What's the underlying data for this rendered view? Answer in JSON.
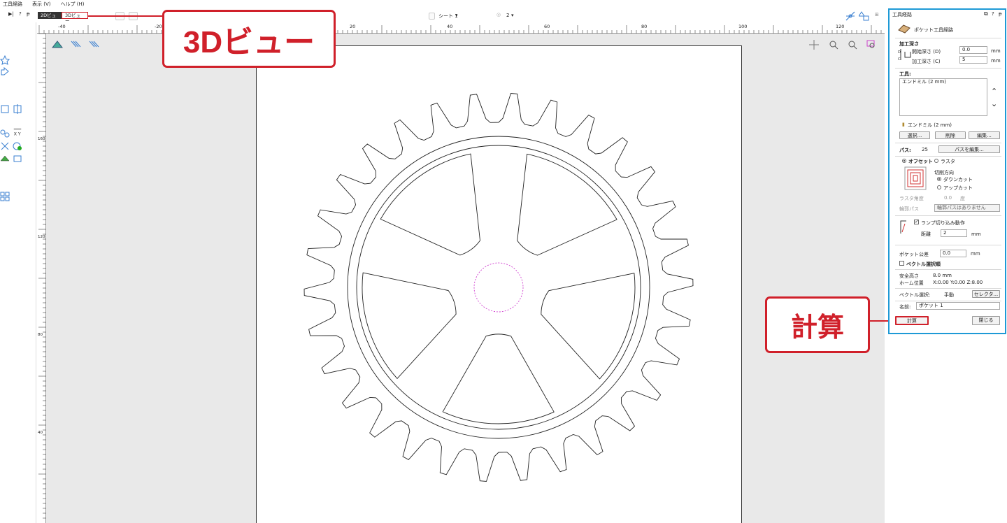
{
  "menu": [
    "工具経路",
    "表示 (V)",
    "ヘルプ (H)"
  ],
  "toolbar": {
    "tab_2d": "2Dビュー",
    "tab_3d": "3Dビュー",
    "sheet_label": "シート 1",
    "layer_label": "2"
  },
  "ruler": {
    "h_labels": [
      "-40",
      "-20",
      "20",
      "40",
      "60",
      "80",
      "100",
      "120"
    ],
    "v_labels": [
      "160",
      "120",
      "80",
      "40",
      "0"
    ]
  },
  "callouts": {
    "view3d": "3Dビュー",
    "calculate": "計算"
  },
  "panel": {
    "header": "工具経路",
    "header_icons": [
      "?",
      "ᵽ"
    ],
    "title": "ポケット工具経路",
    "depth_section": "加工深さ",
    "start_depth_label": "開始深さ (D)",
    "start_depth_value": "0.0",
    "cut_depth_label": "加工深さ (C)",
    "cut_depth_value": "5",
    "unit_mm": "mm",
    "tool_section": "工具:",
    "tool_list_item": "エンドミル (2 mm)",
    "tool_selected": "エンドミル (2 mm)",
    "btn_select": "選択...",
    "btn_delete": "削除",
    "btn_edit": "編集...",
    "pass_label": "パス:",
    "pass_value": "25",
    "btn_edit_pass": "パスを編集...",
    "offset_label": "オフセット",
    "raster_label": "ラスタ",
    "cut_direction_label": "切削方向",
    "down_cut_label": "ダウンカット",
    "up_cut_label": "アップカット",
    "raster_angle_label": "ラスタ角度",
    "raster_angle_value": "0.0",
    "degree_unit": "度",
    "profile_pass_label": "輪郭パス",
    "profile_pass_value": "輪郭パスはありません",
    "ramp_label": "ランプ切り込み動作",
    "distance_label": "距離",
    "distance_value": "2",
    "pocket_allowance_label": "ポケット公差",
    "pocket_allowance_value": "0.0",
    "vector_order_label": "ベクトル選択順",
    "safe_height_label": "安全高さ",
    "safe_height_value": "8.0 mm",
    "home_label": "ホーム位置",
    "home_value": "X:0.00 Y:0.00 Z:8.00",
    "vector_select_label": "ベクトル選択:",
    "vector_select_value": "手動",
    "btn_selector": "セレクタ...",
    "name_label": "名前:",
    "name_value": "ポケット 1",
    "btn_calculate": "計算",
    "btn_close": "閉じる"
  },
  "colors": {
    "accent_red": "#d0202a",
    "panel_blue": "#1e9ad6",
    "toolpath_magenta": "#d040d0"
  }
}
